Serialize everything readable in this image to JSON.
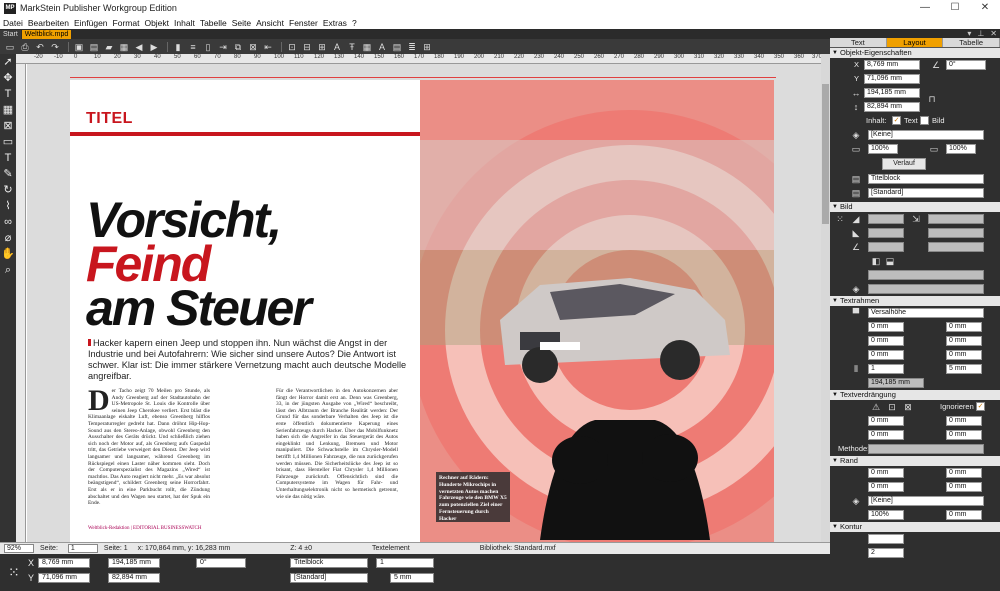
{
  "window": {
    "title": "MarkStein Publisher Workgroup Edition",
    "logo": "MP",
    "controls": [
      "—",
      "☐",
      "✕"
    ]
  },
  "menu": [
    "Datei",
    "Bearbeiten",
    "Einfügen",
    "Format",
    "Objekt",
    "Inhalt",
    "Tabelle",
    "Seite",
    "Ansicht",
    "Fenster",
    "Extras",
    "?"
  ],
  "doc_tabs": [
    {
      "label": "Start",
      "active": false
    },
    {
      "label": "Weltblick.mpd",
      "active": true
    }
  ],
  "ruler_h": [
    "-20",
    "-10",
    "0",
    "10",
    "20",
    "30",
    "40",
    "50",
    "60",
    "70",
    "80",
    "90",
    "100",
    "110",
    "120",
    "130",
    "140",
    "150",
    "160",
    "170",
    "180",
    "190",
    "200",
    "210",
    "220",
    "230",
    "240",
    "250",
    "260",
    "270",
    "280",
    "290",
    "300",
    "310",
    "320",
    "330",
    "340",
    "350",
    "360",
    "370",
    "380",
    "390"
  ],
  "page": {
    "kicker": "TITEL",
    "headline_line1": "Vorsicht,",
    "headline_line2": "Feind",
    "headline_line3": "am Steuer",
    "lead": "Hacker kapern einen Jeep und stoppen ihn. Nun wächst die Angst in der Industrie und bei Autofahrern: Wie sicher sind unsere Autos? Die Antwort ist schwer. Klar ist: Die immer stärkere Vernetzung macht auch deutsche Modelle angreifbar.",
    "dropcap": "D",
    "col1": "er Tacho zeigt 70 Meilen pro Stunde, als Andy Greenberg auf der Stadtautobahn der US-Metropole St. Louis die Kontrolle über seinen Jeep Cherokee verliert. Erst bläst die Klimaanlage eiskalte Luft, ebenso Greenberg hilflos Temperaturregler gedreht hat. Dann dröhnt Hip-Hop-Sound aus den Stereo-Anlage, obwohl Greenberg den Ausschalter des Geräts drückt. Und schließlich ziehen sich noch der Motor auf, als Greenberg aufs Gaspedal tritt, das Getriebe verweigert den Dienst. Der Jeep wird langsamer und langsamer, während Greenberg im Rückspiegel einen Laster näher kommen sieht. Doch der Computerspezialist des Magazins „Wired“ ist machtlos. Das Auto reagiert nicht mehr. „Es war absolut beängstigend“, schildert Greenberg seine Horrorfahrt. Erst als er in eine Parkbucht rollt, die Zündung abschaltet und den Wagen neu startet, hat der Spuk ein Ende.",
    "col2": "Für die Verantwortlichen in den Autokonzernen aber fängt der Horror damit erst an. Denn was Greenberg, 33, in der jüngsten Ausgabe von „Wired“ beschreibt, lässt den Albtraum der Branche Realität werden: Der Grund für das sonderbare Verhalten des Jeep ist die erste öffentlich dokumentierte Kaperung eines Serienfahrzeugs durch Hacker. Über das Mobilfunknetz haben sich die Angreifer in das Steuergerät des Autos eingeklinkt und Lenkung, Bremsen und Motor manipuliert. Die Schwachstelle im Chrysler-Modell betrifft 1,4 Millionen Fahrzeuge, die nun zurückgerufen werden müssen. Die Sicherheitslücke des Jeep ist so brisant, dass Hersteller Fiat Chrysler 1,4 Millionen Fahrzeuge zurückruft. Offensichtlich sind die Computersysteme im Wagen für Fahr- und Unterhaltungselektronik nicht so hermetisch getrennt, wie sie das nötig wäre.",
    "footer": "Weltblick-Redaktion | EDITORIAL BUSINESSWATCH",
    "caption": "Rechner auf Rädern: Hunderte Mikrochips in vernetzten Autos machen Fahrzeuge wie den BMW X5 zum potenziellen Ziel einer Fernsteuerung durch Hacker"
  },
  "status": {
    "zoom": "92%",
    "page_label": "Seite:",
    "page_value": "1",
    "page_info": "Seite: 1",
    "coords": "x: 170,864 mm, y: 16,283 mm",
    "z": "Z: 4 ±0",
    "element": "Textelement",
    "library": "Bibliothek: Standard.mxf"
  },
  "bottom": {
    "x": "8,769 mm",
    "y": "71,096 mm",
    "w": "194,185 mm",
    "h": "82,894 mm",
    "angle": "0°",
    "frame_type": "Titelblock",
    "style": "[Standard]",
    "count": "1",
    "gap": "5 mm"
  },
  "panel": {
    "tabs": [
      "Text",
      "Layout",
      "Tabelle"
    ],
    "active_tab": "Layout",
    "objekt": {
      "title": "Objekt-Eigenschaften",
      "x": "8,769 mm",
      "y": "71,096 mm",
      "w": "194,185 mm",
      "h": "82,894 mm",
      "angle": "0°",
      "content_label": "Inhalt:",
      "text_label": "Text",
      "bild_label": "Bild",
      "color": "[Keine]",
      "pct1": "100%",
      "pct2": "100%",
      "verlauf": "Verlauf",
      "frame_type": "Titelblock",
      "style": "[Standard]"
    },
    "bild": {
      "title": "Bild"
    },
    "textrahmen": {
      "title": "Textrahmen",
      "mode": "Versalhöhe",
      "v1": "0 mm",
      "v2": "0 mm",
      "v3": "0 mm",
      "v4": "0 mm",
      "v5": "0 mm",
      "v6": "0 mm",
      "cols": "1",
      "gap": "5 mm",
      "width": "194,185 mm"
    },
    "textverdraengung": {
      "title": "Textverdrängung",
      "ignore": "Ignorieren",
      "v1": "0 mm",
      "v2": "0 mm",
      "v3": "0 mm",
      "v4": "0 mm",
      "method": "Methode:"
    },
    "rand": {
      "title": "Rand",
      "v1": "0 mm",
      "v2": "0 mm",
      "v3": "0 mm",
      "v4": "0 mm",
      "color": "[Keine]",
      "pct": "100%",
      "stroke": "0 mm"
    },
    "kontur": {
      "title": "Kontur",
      "v1": "2"
    }
  },
  "colors": {
    "accent": "#f0a000",
    "brand_red": "#c8161e",
    "panel_bg": "#2f2f2f",
    "target_pink": "#eb8e86"
  }
}
